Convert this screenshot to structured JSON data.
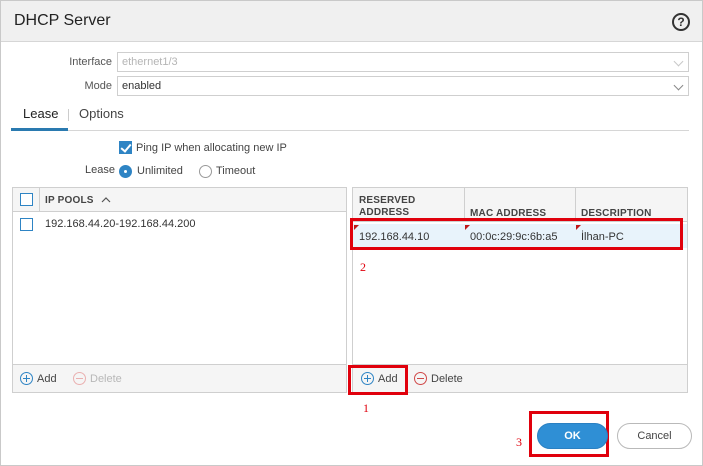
{
  "dialog": {
    "title": "DHCP Server",
    "help_icon": "?"
  },
  "form": {
    "interface_label": "Interface",
    "interface_value": "ethernet1/3",
    "mode_label": "Mode",
    "mode_value": "enabled"
  },
  "tabs": [
    {
      "label": "Lease"
    },
    {
      "label": "Options"
    }
  ],
  "lease": {
    "ping_label": "Ping IP when allocating new IP",
    "lease_label": "Lease",
    "unlimited_label": "Unlimited",
    "timeout_label": "Timeout"
  },
  "ip_pools": {
    "header": "IP POOLS",
    "rows": [
      {
        "value": "192.168.44.20-192.168.44.200"
      }
    ],
    "add_label": "Add",
    "delete_label": "Delete"
  },
  "reserved": {
    "columns": {
      "address": "RESERVED ADDRESS",
      "mac": "MAC ADDRESS",
      "desc": "DESCRIPTION"
    },
    "rows": [
      {
        "address": "192.168.44.10",
        "mac": "00:0c:29:9c:6b:a5",
        "desc": "İlhan-PC"
      }
    ],
    "add_label": "Add",
    "delete_label": "Delete"
  },
  "annotations": {
    "one": "1",
    "two": "2",
    "three": "3"
  },
  "buttons": {
    "ok": "OK",
    "cancel": "Cancel"
  },
  "colors": {
    "accent": "#2f8fd5",
    "annotation_red": "#e0000c",
    "selected_row": "#e8f3fb"
  }
}
